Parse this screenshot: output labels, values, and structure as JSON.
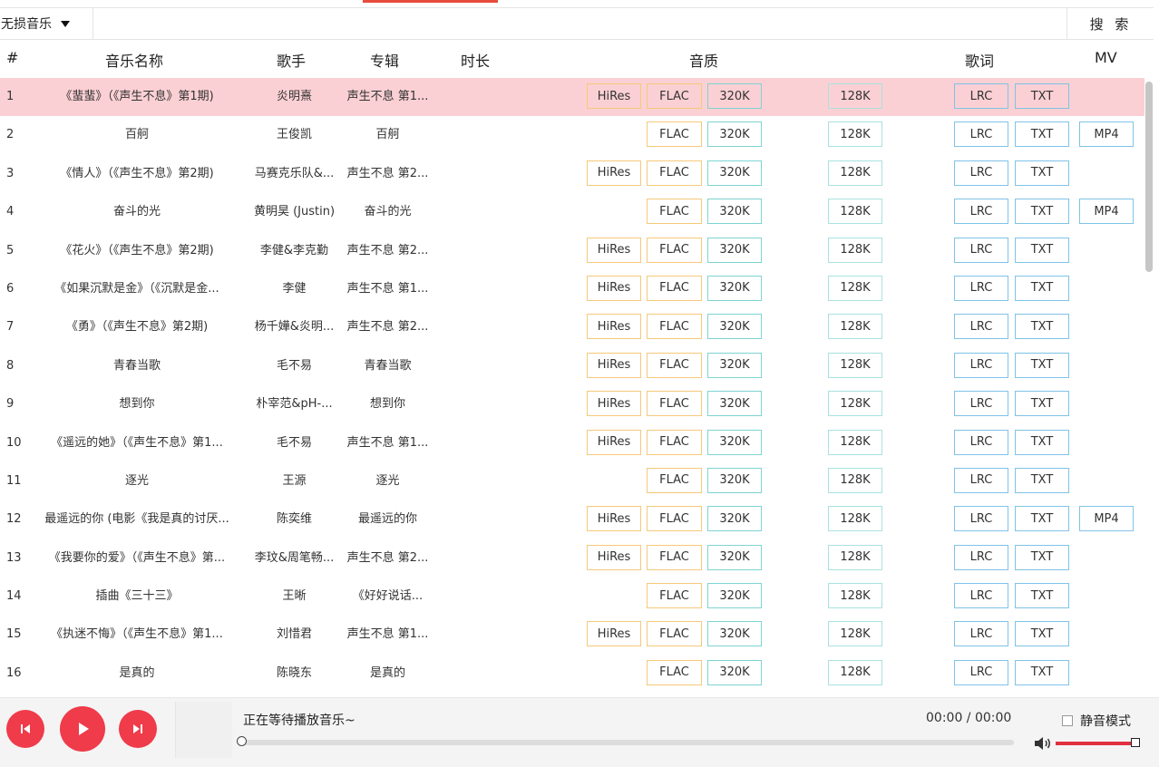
{
  "search": {
    "source": "无损音乐",
    "placeholder": "",
    "value": "",
    "button": "搜 索"
  },
  "columns": {
    "num": "#",
    "name": "音乐名称",
    "singer": "歌手",
    "album": "专辑",
    "duration": "时长",
    "quality": "音质",
    "lyrics": "歌词",
    "mv": "MV"
  },
  "labels": {
    "hires": "HiRes",
    "flac": "FLAC",
    "k320": "320K",
    "k128": "128K",
    "lrc": "LRC",
    "txt": "TXT",
    "mp4": "MP4"
  },
  "rows": [
    {
      "num": "1",
      "name": "《蜚蜚》（《声生不息》第1期)",
      "singer": "炎明熹",
      "album": "声生不息 第1...",
      "hires": true,
      "mv": false
    },
    {
      "num": "2",
      "name": "百舸",
      "singer": "王俊凯",
      "album": "百舸",
      "hires": false,
      "mv": true
    },
    {
      "num": "3",
      "name": "《情人》（《声生不息》第2期)",
      "singer": "马赛克乐队&...",
      "album": "声生不息 第2...",
      "hires": true,
      "mv": false
    },
    {
      "num": "4",
      "name": "奋斗的光",
      "singer": "黄明昊 (Justin)",
      "album": "奋斗的光",
      "hires": false,
      "mv": true
    },
    {
      "num": "5",
      "name": "《花火》（《声生不息》第2期)",
      "singer": "李健&李克勤",
      "album": "声生不息 第2...",
      "hires": true,
      "mv": false
    },
    {
      "num": "6",
      "name": "《如果沉默是金》（《沉默是金...",
      "singer": "李健",
      "album": "声生不息 第1...",
      "hires": true,
      "mv": false
    },
    {
      "num": "7",
      "name": "《勇》（《声生不息》第2期)",
      "singer": "杨千嬅&炎明...",
      "album": "声生不息 第2...",
      "hires": true,
      "mv": false
    },
    {
      "num": "8",
      "name": "青春当歌",
      "singer": "毛不易",
      "album": "青春当歌",
      "hires": true,
      "mv": false
    },
    {
      "num": "9",
      "name": "想到你",
      "singer": "朴宰范&pH-...",
      "album": "想到你",
      "hires": true,
      "mv": false
    },
    {
      "num": "10",
      "name": "《遥远的她》（《声生不息》第1...",
      "singer": "毛不易",
      "album": "声生不息 第1...",
      "hires": true,
      "mv": false
    },
    {
      "num": "11",
      "name": "逐光",
      "singer": "王源",
      "album": "逐光",
      "hires": false,
      "mv": false
    },
    {
      "num": "12",
      "name": "最遥远的你 (电影《我是真的讨厌...",
      "singer": "陈奕维",
      "album": "最遥远的你",
      "hires": true,
      "mv": true
    },
    {
      "num": "13",
      "name": "《我要你的爱》（《声生不息》第...",
      "singer": "李玟&周笔畅...",
      "album": "声生不息 第2...",
      "hires": true,
      "mv": false
    },
    {
      "num": "14",
      "name": "插曲《三十三》",
      "singer": "王晰",
      "album": "《好好说话...",
      "hires": false,
      "mv": false
    },
    {
      "num": "15",
      "name": "《执迷不悔》（《声生不息》第1...",
      "singer": "刘惜君",
      "album": "声生不息 第1...",
      "hires": true,
      "mv": false
    },
    {
      "num": "16",
      "name": "是真的",
      "singer": "陈晓东",
      "album": "是真的",
      "hires": false,
      "mv": false
    }
  ],
  "player": {
    "status": "正在等待播放音乐~",
    "time": "00:00 / 00:00",
    "mute_label": "静音模式",
    "progress": 0,
    "volume": 1.0
  },
  "colors": {
    "accent": "#ef3b4a",
    "selected_row": "#fbd0d4"
  }
}
